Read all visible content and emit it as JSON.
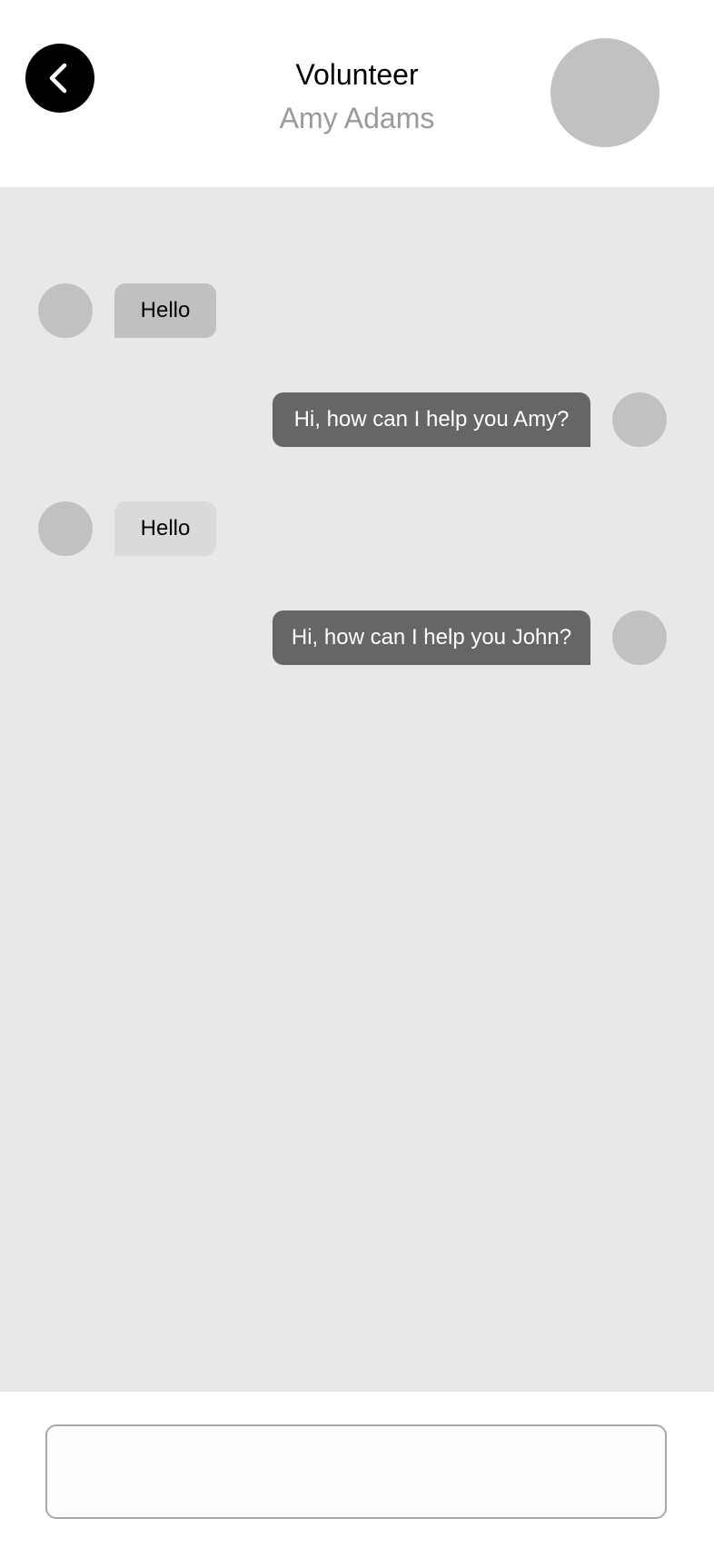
{
  "header": {
    "title": "Volunteer",
    "subtitle": "Amy Adams",
    "back_icon": "chevron-left-icon",
    "avatar": "profile-avatar"
  },
  "messages": [
    {
      "direction": "incoming",
      "text": "Hello",
      "bubble_color": "#c0c0c0"
    },
    {
      "direction": "outgoing",
      "text": "Hi, how can I help you Amy?",
      "bubble_color": "#666666"
    },
    {
      "direction": "incoming",
      "text": "Hello",
      "bubble_color": "#dadada"
    },
    {
      "direction": "outgoing",
      "text": "Hi, how can I help you John?",
      "bubble_color": "#666666"
    }
  ],
  "composer": {
    "value": "",
    "placeholder": ""
  },
  "colors": {
    "chat_background": "#e8e8e8",
    "avatar": "#c1c1c1",
    "back_button": "#000000",
    "subtitle": "#9a9a9a"
  }
}
